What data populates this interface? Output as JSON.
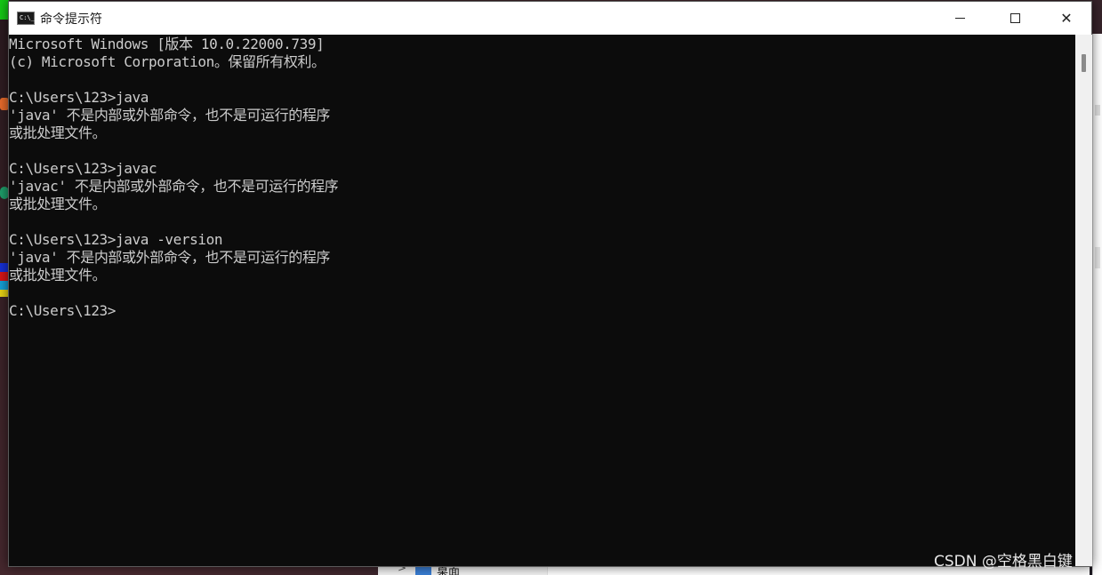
{
  "window": {
    "title": "命令提示符",
    "icon": "cmd-icon",
    "icon_text": "C:\\_",
    "minimize_icon": "minimize-icon",
    "maximize_icon": "maximize-icon",
    "close_icon": "close-icon",
    "close_label": "✕"
  },
  "console": {
    "lines": [
      "Microsoft Windows [版本 10.0.22000.739]",
      "(c) Microsoft Corporation。保留所有权利。",
      "",
      "C:\\Users\\123>java",
      "'java' 不是内部或外部命令，也不是可运行的程序",
      "或批处理文件。",
      "",
      "C:\\Users\\123>javac",
      "'javac' 不是内部或外部命令，也不是可运行的程序",
      "或批处理文件。",
      "",
      "C:\\Users\\123>java -version",
      "'java' 不是内部或外部命令，也不是可运行的程序",
      "或批处理文件。",
      "",
      "C:\\Users\\123>"
    ],
    "background": "#0c0c0c",
    "foreground": "#cccccc"
  },
  "background_explorer": {
    "item_label": "桌面",
    "folder_icon": "folder-icon",
    "chevron_icon": "chevron-right-icon",
    "chevron_glyph": ">"
  },
  "watermark": "CSDN @空格黑白键"
}
